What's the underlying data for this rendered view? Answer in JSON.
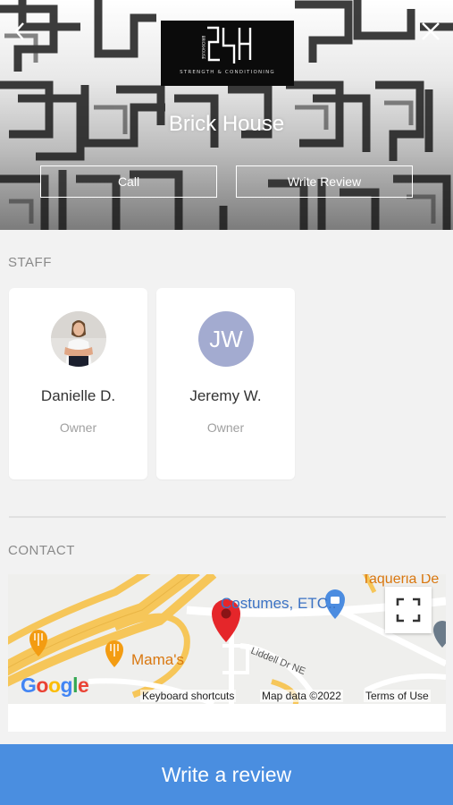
{
  "business": {
    "logo_tagline": "STRENGTH & CONDITIONING",
    "logo_side_text": "BRICKHOUSE",
    "name": "Brick House"
  },
  "header": {
    "back_icon": "chevron-left-icon",
    "close_icon": "close-icon",
    "call_label": "Call",
    "write_review_label": "Write Review"
  },
  "staff": {
    "section_label": "STAFF",
    "members": [
      {
        "name": "Danielle D.",
        "role": "Owner",
        "avatar": "photo"
      },
      {
        "name": "Jeremy W.",
        "role": "Owner",
        "avatar_initials": "JW",
        "avatar_color": "#a3abd0"
      }
    ]
  },
  "contact": {
    "section_label": "CONTACT",
    "map": {
      "place_labels": [
        "Costumes, ETC..",
        "Mama's",
        "Taqueria De"
      ],
      "street_label": "Liddell Dr NE",
      "attribution": {
        "brand": "Google",
        "keyboard_shortcuts": "Keyboard shortcuts",
        "map_data": "Map data ©2022",
        "terms": "Terms of Use"
      }
    }
  },
  "footer": {
    "cta_label": "Write a review",
    "cta_color": "#4a8ee0"
  }
}
